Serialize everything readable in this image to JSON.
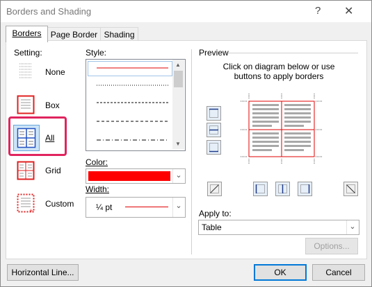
{
  "window": {
    "title": "Borders and Shading",
    "help_glyph": "?",
    "close_glyph": "✕"
  },
  "tabs": [
    {
      "label": "Borders",
      "active": true
    },
    {
      "label": "Page Border",
      "active": false
    },
    {
      "label": "Shading",
      "active": false
    }
  ],
  "setting": {
    "heading": "Setting:",
    "options": [
      {
        "label": "None",
        "selected": false
      },
      {
        "label": "Box",
        "selected": false
      },
      {
        "label": "All",
        "selected": true
      },
      {
        "label": "Grid",
        "selected": false
      },
      {
        "label": "Custom",
        "selected": false
      }
    ]
  },
  "style": {
    "heading": "Style:",
    "line_styles": [
      "solid",
      "dotted",
      "dashed",
      "dashed-long",
      "dash-dot"
    ]
  },
  "color": {
    "heading": "Color:",
    "value": "#ff0000"
  },
  "width": {
    "heading": "Width:",
    "value": "¼ pt"
  },
  "preview": {
    "heading": "Preview",
    "instruction_line1": "Click on diagram below or use",
    "instruction_line2": "buttons to apply borders"
  },
  "apply_to": {
    "heading": "Apply to:",
    "value": "Table"
  },
  "buttons": {
    "options": "Options...",
    "horizontal_line": "Horizontal Line...",
    "ok": "OK",
    "cancel": "Cancel"
  },
  "colors": {
    "accent_red": "#ff0000",
    "highlight_pink": "#e0245e",
    "select_blue": "#cce4f7"
  }
}
